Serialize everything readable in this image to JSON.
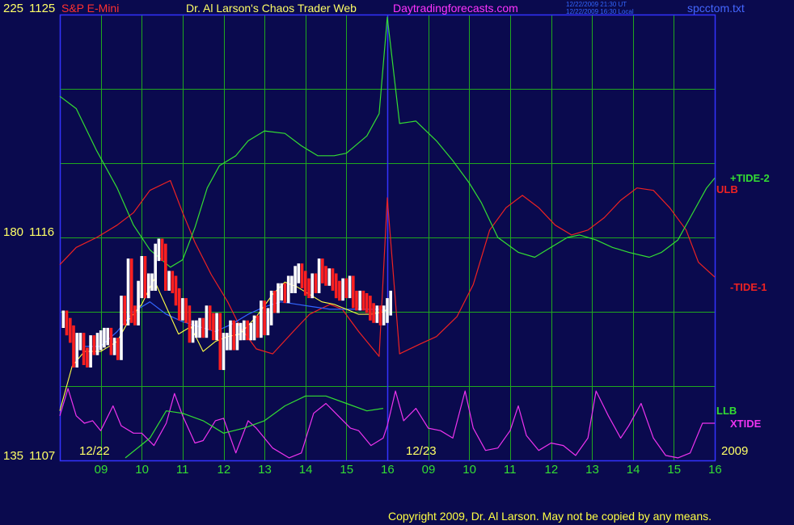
{
  "header": {
    "symbol": "S&P E-Mini",
    "title": "Dr. Al Larson's Chaos Trader Web",
    "site": "Daytradingforecasts.com",
    "stamp_ut": "12/22/2009 21:30 UT",
    "stamp_local": "12/22/2009 16:30 Local",
    "filename": "spcctom.txt"
  },
  "footer": {
    "copyright": "Copyright 2009, Dr. Al Larson. May not be copied by any means."
  },
  "colors": {
    "background": "#0a0a4e",
    "grid": "#1fa81f",
    "frame": "#3333ff",
    "up_bar": "#ffffff",
    "down_bar": "#ff2020",
    "tide2": "#33dd33",
    "tide1": "#ee2222",
    "xtide": "#ee33ee",
    "llb": "#33dd33",
    "avg_fast": "#ffff44",
    "avg_slow": "#3366ff"
  },
  "chart_data": {
    "type": "line",
    "y_axis": {
      "ticks": [
        {
          "left": "225",
          "right": "1125",
          "price": 1125
        },
        {
          "left": "180",
          "right": "1116",
          "price": 1116
        },
        {
          "left": "135",
          "right": "1107",
          "price": 1107
        }
      ],
      "ylim": [
        1107,
        1125
      ]
    },
    "x_axis": {
      "hours": [
        "09",
        "10",
        "11",
        "12",
        "13",
        "14",
        "15",
        "16",
        "09",
        "10",
        "11",
        "12",
        "13",
        "14",
        "15",
        "16"
      ],
      "day_labels": [
        "12/22",
        "12/23",
        "2009"
      ],
      "day1_range": [
        8.0,
        16.0
      ],
      "day2_range": [
        16.0,
        24.0
      ]
    },
    "grid": true,
    "series_labels": {
      "tide2": "+TIDE-2",
      "ulb": "ULB",
      "tide1": "-TIDE-1",
      "llb": "LLB",
      "xtide": "XTIDE"
    },
    "tide2": [
      [
        8.0,
        1121.7
      ],
      [
        8.4,
        1121.2
      ],
      [
        8.9,
        1119.5
      ],
      [
        9.4,
        1118.0
      ],
      [
        9.8,
        1116.5
      ],
      [
        10.2,
        1115.5
      ],
      [
        10.7,
        1114.8
      ],
      [
        11.0,
        1115.1
      ],
      [
        11.3,
        1116.4
      ],
      [
        11.6,
        1118.0
      ],
      [
        11.9,
        1118.9
      ],
      [
        12.3,
        1119.3
      ],
      [
        12.6,
        1119.9
      ],
      [
        13.0,
        1120.3
      ],
      [
        13.5,
        1120.2
      ],
      [
        13.9,
        1119.7
      ],
      [
        14.3,
        1119.3
      ],
      [
        14.7,
        1119.3
      ],
      [
        15.0,
        1119.4
      ],
      [
        15.5,
        1120.1
      ],
      [
        15.8,
        1121.0
      ],
      [
        16.0,
        1124.9
      ],
      [
        16.3,
        1120.6
      ],
      [
        16.7,
        1120.7
      ],
      [
        17.2,
        1119.9
      ],
      [
        17.6,
        1119.1
      ],
      [
        18.0,
        1118.2
      ],
      [
        18.3,
        1117.4
      ],
      [
        18.7,
        1116.0
      ],
      [
        19.2,
        1115.4
      ],
      [
        19.6,
        1115.2
      ],
      [
        19.9,
        1115.5
      ],
      [
        20.4,
        1116.0
      ],
      [
        20.7,
        1116.1
      ],
      [
        21.1,
        1115.9
      ],
      [
        21.5,
        1115.6
      ],
      [
        21.9,
        1115.4
      ],
      [
        22.4,
        1115.2
      ],
      [
        22.7,
        1115.4
      ],
      [
        23.1,
        1115.9
      ],
      [
        23.4,
        1116.8
      ],
      [
        23.8,
        1118.0
      ],
      [
        24.0,
        1118.4
      ]
    ],
    "tide1": [
      [
        8.0,
        1114.9
      ],
      [
        8.4,
        1115.6
      ],
      [
        8.9,
        1116.0
      ],
      [
        9.4,
        1116.5
      ],
      [
        9.8,
        1117.0
      ],
      [
        10.2,
        1117.9
      ],
      [
        10.7,
        1118.3
      ],
      [
        11.0,
        1117.0
      ],
      [
        11.3,
        1115.8
      ],
      [
        11.7,
        1114.5
      ],
      [
        12.1,
        1113.4
      ],
      [
        12.4,
        1112.4
      ],
      [
        12.8,
        1111.5
      ],
      [
        13.2,
        1111.3
      ],
      [
        13.7,
        1112.2
      ],
      [
        14.1,
        1112.9
      ],
      [
        14.6,
        1113.3
      ],
      [
        14.9,
        1113.1
      ],
      [
        15.3,
        1112.2
      ],
      [
        15.8,
        1111.2
      ],
      [
        16.0,
        1117.6
      ],
      [
        16.3,
        1111.3
      ],
      [
        16.8,
        1111.7
      ],
      [
        17.2,
        1112.0
      ],
      [
        17.7,
        1112.8
      ],
      [
        18.1,
        1114.1
      ],
      [
        18.5,
        1116.3
      ],
      [
        18.9,
        1117.2
      ],
      [
        19.3,
        1117.7
      ],
      [
        19.7,
        1117.2
      ],
      [
        20.1,
        1116.5
      ],
      [
        20.5,
        1116.1
      ],
      [
        20.9,
        1116.3
      ],
      [
        21.3,
        1116.8
      ],
      [
        21.7,
        1117.5
      ],
      [
        22.1,
        1118.0
      ],
      [
        22.5,
        1117.9
      ],
      [
        22.9,
        1117.2
      ],
      [
        23.3,
        1116.3
      ],
      [
        23.6,
        1115.0
      ],
      [
        24.0,
        1114.4
      ]
    ],
    "xtide": [
      [
        8.0,
        1108.8
      ],
      [
        8.2,
        1109.9
      ],
      [
        8.4,
        1108.8
      ],
      [
        8.6,
        1108.5
      ],
      [
        8.8,
        1108.6
      ],
      [
        9.0,
        1108.2
      ],
      [
        9.3,
        1109.2
      ],
      [
        9.5,
        1108.4
      ],
      [
        9.8,
        1108.1
      ],
      [
        10.0,
        1108.1
      ],
      [
        10.3,
        1107.6
      ],
      [
        10.6,
        1108.5
      ],
      [
        10.8,
        1109.7
      ],
      [
        11.0,
        1108.8
      ],
      [
        11.3,
        1107.7
      ],
      [
        11.5,
        1107.8
      ],
      [
        11.8,
        1108.6
      ],
      [
        12.0,
        1108.7
      ],
      [
        12.3,
        1107.3
      ],
      [
        12.6,
        1108.6
      ],
      [
        12.8,
        1108.3
      ],
      [
        13.2,
        1107.5
      ],
      [
        13.6,
        1107.1
      ],
      [
        13.9,
        1107.3
      ],
      [
        14.2,
        1108.9
      ],
      [
        14.5,
        1109.3
      ],
      [
        14.8,
        1108.8
      ],
      [
        15.1,
        1108.3
      ],
      [
        15.3,
        1108.2
      ],
      [
        15.6,
        1107.6
      ],
      [
        15.9,
        1107.9
      ],
      [
        16.0,
        1108.4
      ],
      [
        16.2,
        1109.8
      ],
      [
        16.4,
        1108.6
      ],
      [
        16.7,
        1109.1
      ],
      [
        17.0,
        1108.3
      ],
      [
        17.3,
        1108.2
      ],
      [
        17.6,
        1107.9
      ],
      [
        17.9,
        1109.8
      ],
      [
        18.1,
        1108.3
      ],
      [
        18.4,
        1107.4
      ],
      [
        18.7,
        1107.5
      ],
      [
        19.0,
        1108.2
      ],
      [
        19.2,
        1109.2
      ],
      [
        19.4,
        1108.0
      ],
      [
        19.7,
        1107.4
      ],
      [
        20.0,
        1107.7
      ],
      [
        20.3,
        1107.6
      ],
      [
        20.6,
        1107.2
      ],
      [
        20.9,
        1107.9
      ],
      [
        21.1,
        1109.8
      ],
      [
        21.4,
        1108.8
      ],
      [
        21.7,
        1107.9
      ],
      [
        21.9,
        1108.4
      ],
      [
        22.2,
        1109.3
      ],
      [
        22.5,
        1107.9
      ],
      [
        22.8,
        1107.2
      ],
      [
        23.1,
        1107.1
      ],
      [
        23.4,
        1107.3
      ],
      [
        23.7,
        1108.5
      ],
      [
        24.0,
        1108.5
      ]
    ],
    "llb": [
      [
        9.6,
        1107.1
      ],
      [
        10.2,
        1107.9
      ],
      [
        10.6,
        1109.0
      ],
      [
        11.0,
        1108.9
      ],
      [
        11.5,
        1108.6
      ],
      [
        12.0,
        1108.1
      ],
      [
        12.5,
        1108.3
      ],
      [
        13.0,
        1108.6
      ],
      [
        13.5,
        1109.2
      ],
      [
        14.0,
        1109.6
      ],
      [
        14.5,
        1109.6
      ],
      [
        15.0,
        1109.3
      ],
      [
        15.5,
        1109.0
      ],
      [
        15.9,
        1109.1
      ]
    ],
    "avg_fast": [
      [
        8.0,
        1109.0
      ],
      [
        8.3,
        1110.8
      ],
      [
        8.6,
        1111.4
      ],
      [
        9.0,
        1111.4
      ],
      [
        9.4,
        1111.8
      ],
      [
        9.7,
        1112.7
      ],
      [
        10.0,
        1113.3
      ],
      [
        10.3,
        1114.3
      ],
      [
        10.6,
        1113.2
      ],
      [
        10.9,
        1112.1
      ],
      [
        11.2,
        1112.4
      ],
      [
        11.5,
        1111.4
      ],
      [
        11.8,
        1111.8
      ],
      [
        12.1,
        1112.0
      ],
      [
        12.4,
        1112.1
      ],
      [
        12.8,
        1112.8
      ],
      [
        13.2,
        1113.7
      ],
      [
        13.5,
        1114.2
      ],
      [
        13.8,
        1114.0
      ],
      [
        14.1,
        1113.7
      ],
      [
        14.4,
        1113.4
      ],
      [
        14.7,
        1113.3
      ],
      [
        15.0,
        1113.1
      ],
      [
        15.3,
        1112.9
      ],
      [
        15.6,
        1112.9
      ],
      [
        15.9,
        1113.0
      ],
      [
        16.0,
        1113.1
      ]
    ],
    "avg_slow": [
      [
        8.6,
        1111.6
      ],
      [
        9.0,
        1111.6
      ],
      [
        9.4,
        1112.2
      ],
      [
        9.8,
        1113.0
      ],
      [
        10.2,
        1113.4
      ],
      [
        10.6,
        1112.9
      ],
      [
        11.0,
        1112.6
      ],
      [
        11.4,
        1112.4
      ],
      [
        11.8,
        1112.2
      ],
      [
        12.2,
        1112.5
      ],
      [
        12.6,
        1112.9
      ],
      [
        13.0,
        1113.2
      ],
      [
        13.4,
        1113.4
      ],
      [
        13.8,
        1113.3
      ],
      [
        14.2,
        1113.2
      ],
      [
        14.6,
        1113.1
      ],
      [
        15.0,
        1113.1
      ],
      [
        15.4,
        1113.1
      ],
      [
        15.8,
        1113.1
      ],
      [
        16.0,
        1113.0
      ]
    ],
    "bars": {
      "start_hour": 8.05,
      "bar_hours": 0.0833,
      "closes": [
        1112.7,
        1112.4,
        1112.1,
        1111.1,
        1111.8,
        1111.8,
        1111.2,
        1111.1,
        1111.7,
        1111.6,
        1111.8,
        1111.9,
        1112.0,
        1112.0,
        1111.6,
        1111.6,
        1111.4,
        1113.3,
        1112.8,
        1114.8,
        1112.9,
        1112.8,
        1113.9,
        1114.9,
        1113.9,
        1114.2,
        1114.2,
        1115.4,
        1115.6,
        1115.4,
        1114.2,
        1114.3,
        1114.1,
        1113.6,
        1113.0,
        1113.2,
        1112.9,
        1112.1,
        1112.3,
        1112.3,
        1112.4,
        1112.3,
        1112.9,
        1112.6,
        1112.2,
        1112.6,
        1111.0,
        1111.8,
        1111.8,
        1112.3,
        1111.8,
        1112.2,
        1112.2,
        1112.3,
        1112.2,
        1112.2,
        1112.5,
        1112.3,
        1113.1,
        1112.4,
        1112.8,
        1113.5,
        1113.3,
        1113.8,
        1113.8,
        1113.7,
        1114.1,
        1114.1,
        1114.5,
        1114.6,
        1114.3,
        1114.0,
        1113.9,
        1114.2,
        1114.1,
        1114.8,
        1114.5,
        1114.4,
        1114.4,
        1114.2,
        1113.9,
        1113.8,
        1114.0,
        1113.9,
        1114.1,
        1113.5,
        1113.4,
        1113.5,
        1113.4,
        1113.3,
        1113.0,
        1112.9,
        1112.9,
        1112.8,
        1112.9,
        1113.2,
        1113.5
      ]
    }
  }
}
